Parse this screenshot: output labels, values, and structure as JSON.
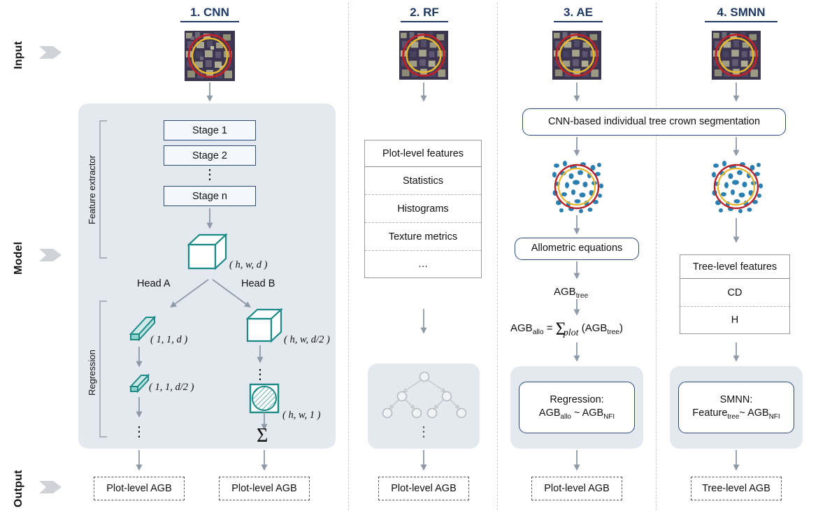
{
  "figure": {
    "type": "method-comparison-flowchart",
    "row_labels": [
      {
        "label": "Input",
        "icon": "chevron-right-marker"
      },
      {
        "label": "Model",
        "icon": "chevron-right-marker"
      },
      {
        "label": "Output",
        "icon": "chevron-right-marker"
      }
    ],
    "colors": {
      "navy": "#2b4a7d",
      "title_navy": "#1f3864",
      "teal": "#1b8a86",
      "panel_bg": "#e4e8ef",
      "arrow_grey": "#8e9aa8",
      "separator": "#c9ccd1",
      "crown_blue": "#2b7fb0",
      "plot_circle_red": "#b8222b",
      "plot_circle_yellow": "#e8b62c"
    }
  },
  "columns": [
    {
      "id": "cnn",
      "title": "1. CNN",
      "input": {
        "icon": "satellite-plot-thumbnail",
        "alt": "aerial forest plot with red and yellow plot circles"
      },
      "feature_extractor": {
        "bracket_label": "Feature extractor",
        "stages": [
          "Stage 1",
          "Stage 2",
          "Stage n"
        ],
        "stage_ellipsis": "⋮",
        "tensor_shape": "( h, w, d )",
        "tensor_icon": "cube-3d"
      },
      "regression": {
        "bracket_label": "Regression",
        "heads": [
          {
            "name": "Head A",
            "nodes": [
              {
                "icon": "vector-bar",
                "shape": "( 1, 1, d )"
              },
              {
                "icon": "vector-bar-small",
                "shape": "( 1, 1, d/2 )"
              }
            ],
            "ellipsis": "⋮",
            "output": "Plot-level AGB"
          },
          {
            "name": "Head B",
            "nodes": [
              {
                "icon": "cube-3d",
                "shape": "( h, w, d/2 )"
              },
              {
                "icon": "feature-map-square",
                "shape": "( h, w, 1 )"
              }
            ],
            "ellipsis": "⋮",
            "sum_symbol": "Σ",
            "output": "Plot-level AGB"
          }
        ]
      }
    },
    {
      "id": "rf",
      "title": "2. RF",
      "input": {
        "icon": "satellite-plot-thumbnail",
        "alt": "aerial forest plot with red and yellow plot circles"
      },
      "feature_table": {
        "header": "Plot-level features",
        "rows": [
          "Statistics",
          "Histograms",
          "Texture metrics",
          "…"
        ]
      },
      "model": {
        "icon": "decision-tree-diagram",
        "ellipsis": "⋮"
      },
      "output": "Plot-level AGB"
    },
    {
      "id": "ae",
      "title": "3. AE",
      "input": {
        "icon": "satellite-plot-thumbnail",
        "alt": "aerial forest plot with red and yellow plot circles"
      },
      "segmentation_box": "CNN-based individual tree crown segmentation",
      "segmented_image": {
        "icon": "segmented-crowns-thumbnail",
        "alt": "segmented tree crowns within plot circles"
      },
      "allometric_box": "Allometric equations",
      "agb_tree_label_html": "AGB<sub>tree</sub>",
      "agb_formula_html": "AGB<sub>allo</sub> = <span class='big-sum'>Σ</span><i>plot</i> (AGB<sub>tree</sub>)",
      "regression_box_line1": "Regression:",
      "regression_box_line2_html": "AGB<sub>allo</sub> ~ AGB<sub>NFI</sub>",
      "output": "Plot-level AGB"
    },
    {
      "id": "smnn",
      "title": "4. SMNN",
      "input": {
        "icon": "satellite-plot-thumbnail",
        "alt": "aerial forest plot with red and yellow plot circles"
      },
      "segmentation_box": "CNN-based individual tree crown segmentation",
      "segmented_image": {
        "icon": "segmented-crowns-thumbnail",
        "alt": "segmented tree crowns within plot circles"
      },
      "feature_table": {
        "header": "Tree-level features",
        "rows": [
          "CD",
          "H"
        ]
      },
      "model_box_line1": "SMNN:",
      "model_box_line2_html": "Feature<sub>tree</sub>~ AGB<sub>NFI</sub>",
      "output": "Tree-level AGB"
    }
  ]
}
